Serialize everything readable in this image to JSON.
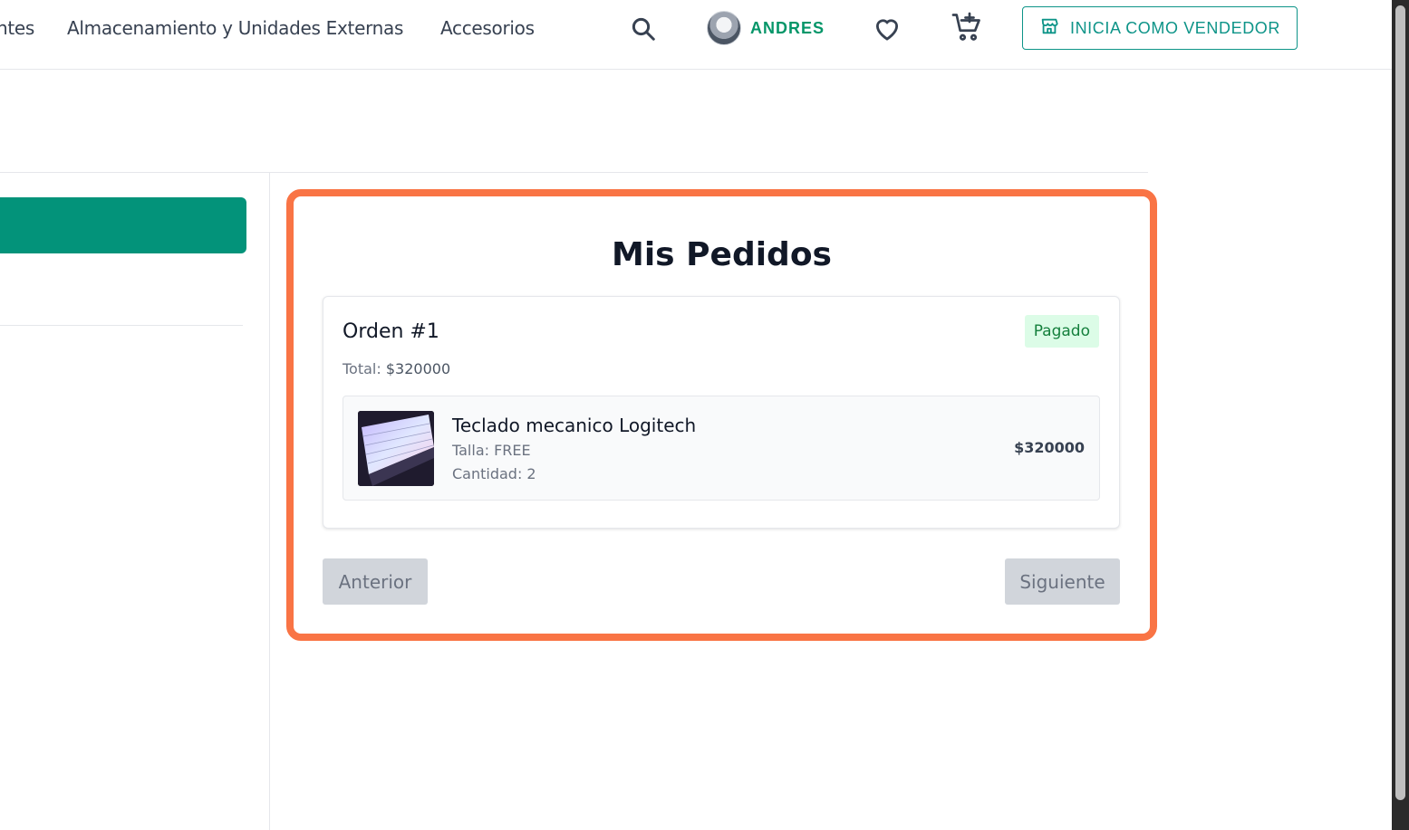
{
  "header": {
    "nav_links": [
      "ntes",
      "Almacenamiento y Unidades Externas",
      "Accesorios"
    ],
    "user_name": "ANDRES",
    "seller_button_label": "INICIA COMO VENDEDOR",
    "icons": [
      "search-icon",
      "avatar",
      "heart-icon",
      "cart-add-icon",
      "store-icon"
    ]
  },
  "sidebar": {
    "accent_color": "#03937a"
  },
  "orders": {
    "title": "Mis Pedidos",
    "highlight_color": "#f97445",
    "items": [
      {
        "title": "Orden #1",
        "status": "Pagado",
        "total_label": "Total:",
        "total_value": "$320000",
        "products": [
          {
            "name": "Teclado mecanico Logitech",
            "size": "Talla: FREE",
            "quantity": "Cantidad: 2",
            "price": "$320000"
          }
        ]
      }
    ],
    "prev_label": "Anterior",
    "next_label": "Siguiente"
  }
}
